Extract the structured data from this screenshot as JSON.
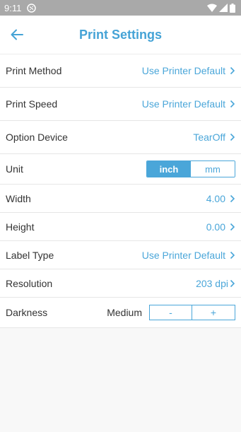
{
  "status": {
    "time": "9:11"
  },
  "header": {
    "title": "Print Settings"
  },
  "rows": {
    "print_method": {
      "label": "Print Method",
      "value": "Use Printer Default"
    },
    "print_speed": {
      "label": "Print Speed",
      "value": "Use Printer Default"
    },
    "option_device": {
      "label": "Option Device",
      "value": "TearOff"
    },
    "unit": {
      "label": "Unit",
      "options": [
        "inch",
        "mm"
      ],
      "selected": "inch"
    },
    "width": {
      "label": "Width",
      "value": "4.00"
    },
    "height": {
      "label": "Height",
      "value": "0.00"
    },
    "label_type": {
      "label": "Label Type",
      "value": "Use Printer Default"
    },
    "resolution": {
      "label": "Resolution",
      "value": "203 dpi"
    },
    "darkness": {
      "label": "Darkness",
      "value": "Medium",
      "minus": "-",
      "plus": "+"
    }
  },
  "colors": {
    "accent": "#4aa6d9",
    "title": "#45a3d6",
    "statusbar": "#a9a9a9",
    "background": "#f8f8f8"
  }
}
